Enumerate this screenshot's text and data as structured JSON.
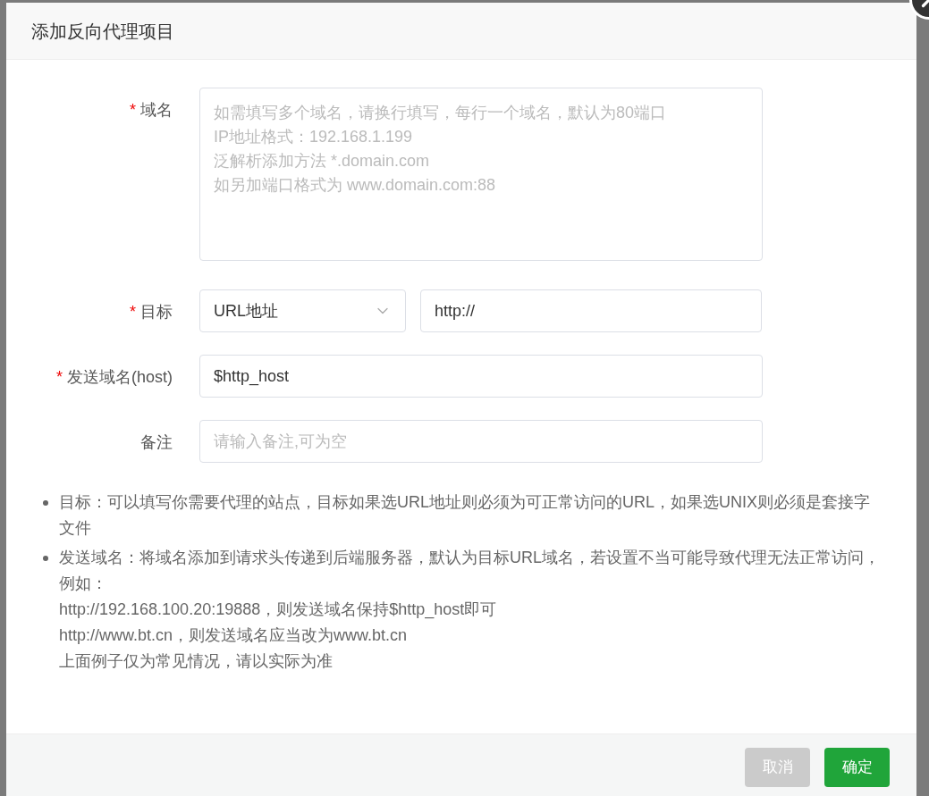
{
  "dialog": {
    "title": "添加反向代理项目"
  },
  "required_marker": "*",
  "fields": [
    {
      "kind": "textarea",
      "label": "域名",
      "required": true,
      "placeholder": "如需填写多个域名，请换行填写，每行一个域名，默认为80端口\nIP地址格式：192.168.1.199\n泛解析添加方法 *.domain.com\n如另加端口格式为 www.domain.com:88"
    },
    {
      "kind": "select_input",
      "label": "目标",
      "required": true,
      "select_value": "URL地址",
      "value": "http://"
    },
    {
      "kind": "input",
      "label": "发送域名(host)",
      "required": true,
      "value": "$http_host"
    },
    {
      "kind": "input",
      "label": "备注",
      "required": false,
      "placeholder": "请输入备注,可为空"
    }
  ],
  "notes": [
    {
      "lines": [
        "目标：可以填写你需要代理的站点，目标如果选URL地址则必须为可正常访问的URL，如果选UNIX则必须是套接字文件"
      ]
    },
    {
      "lines": [
        "发送域名：将域名添加到请求头传递到后端服务器，默认为目标URL域名，若设置不当可能导致代理无法正常访问，例如：",
        "http://192.168.100.20:19888，则发送域名保持$http_host即可",
        "http://www.bt.cn，则发送域名应当改为www.bt.cn",
        "上面例子仅为常见情况，请以实际为准"
      ]
    }
  ],
  "buttons": [
    {
      "kind": "cancel",
      "label": "取消"
    },
    {
      "kind": "primary",
      "label": "确定"
    }
  ]
}
